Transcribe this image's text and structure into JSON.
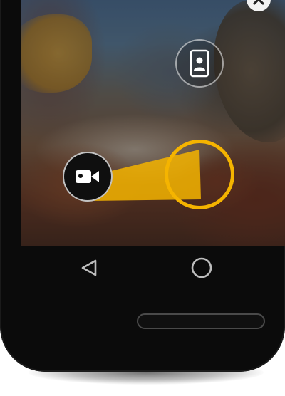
{
  "screen": {
    "top_buttons": {
      "close": {
        "icon": "close-icon",
        "bg_color": "#f2f2f2",
        "icon_color": "#222222"
      },
      "switch_camera": {
        "icon": "front-camera-person-icon",
        "icon_color": "#ffffff"
      }
    },
    "capture": {
      "mode": {
        "icon": "video-camera-icon",
        "bg_color": "#0f0f0f",
        "icon_color": "#ffffff"
      },
      "shutter": {
        "ring_color": "#f5b400"
      },
      "beam_color": "#f5b400"
    }
  },
  "navbar": {
    "back": {
      "icon": "back-triangle-icon"
    },
    "home": {
      "icon": "home-circle-icon"
    },
    "icon_color": "#bdbdbd"
  },
  "device": {
    "speaker": {
      "icon": "speaker-grille-icon"
    }
  }
}
